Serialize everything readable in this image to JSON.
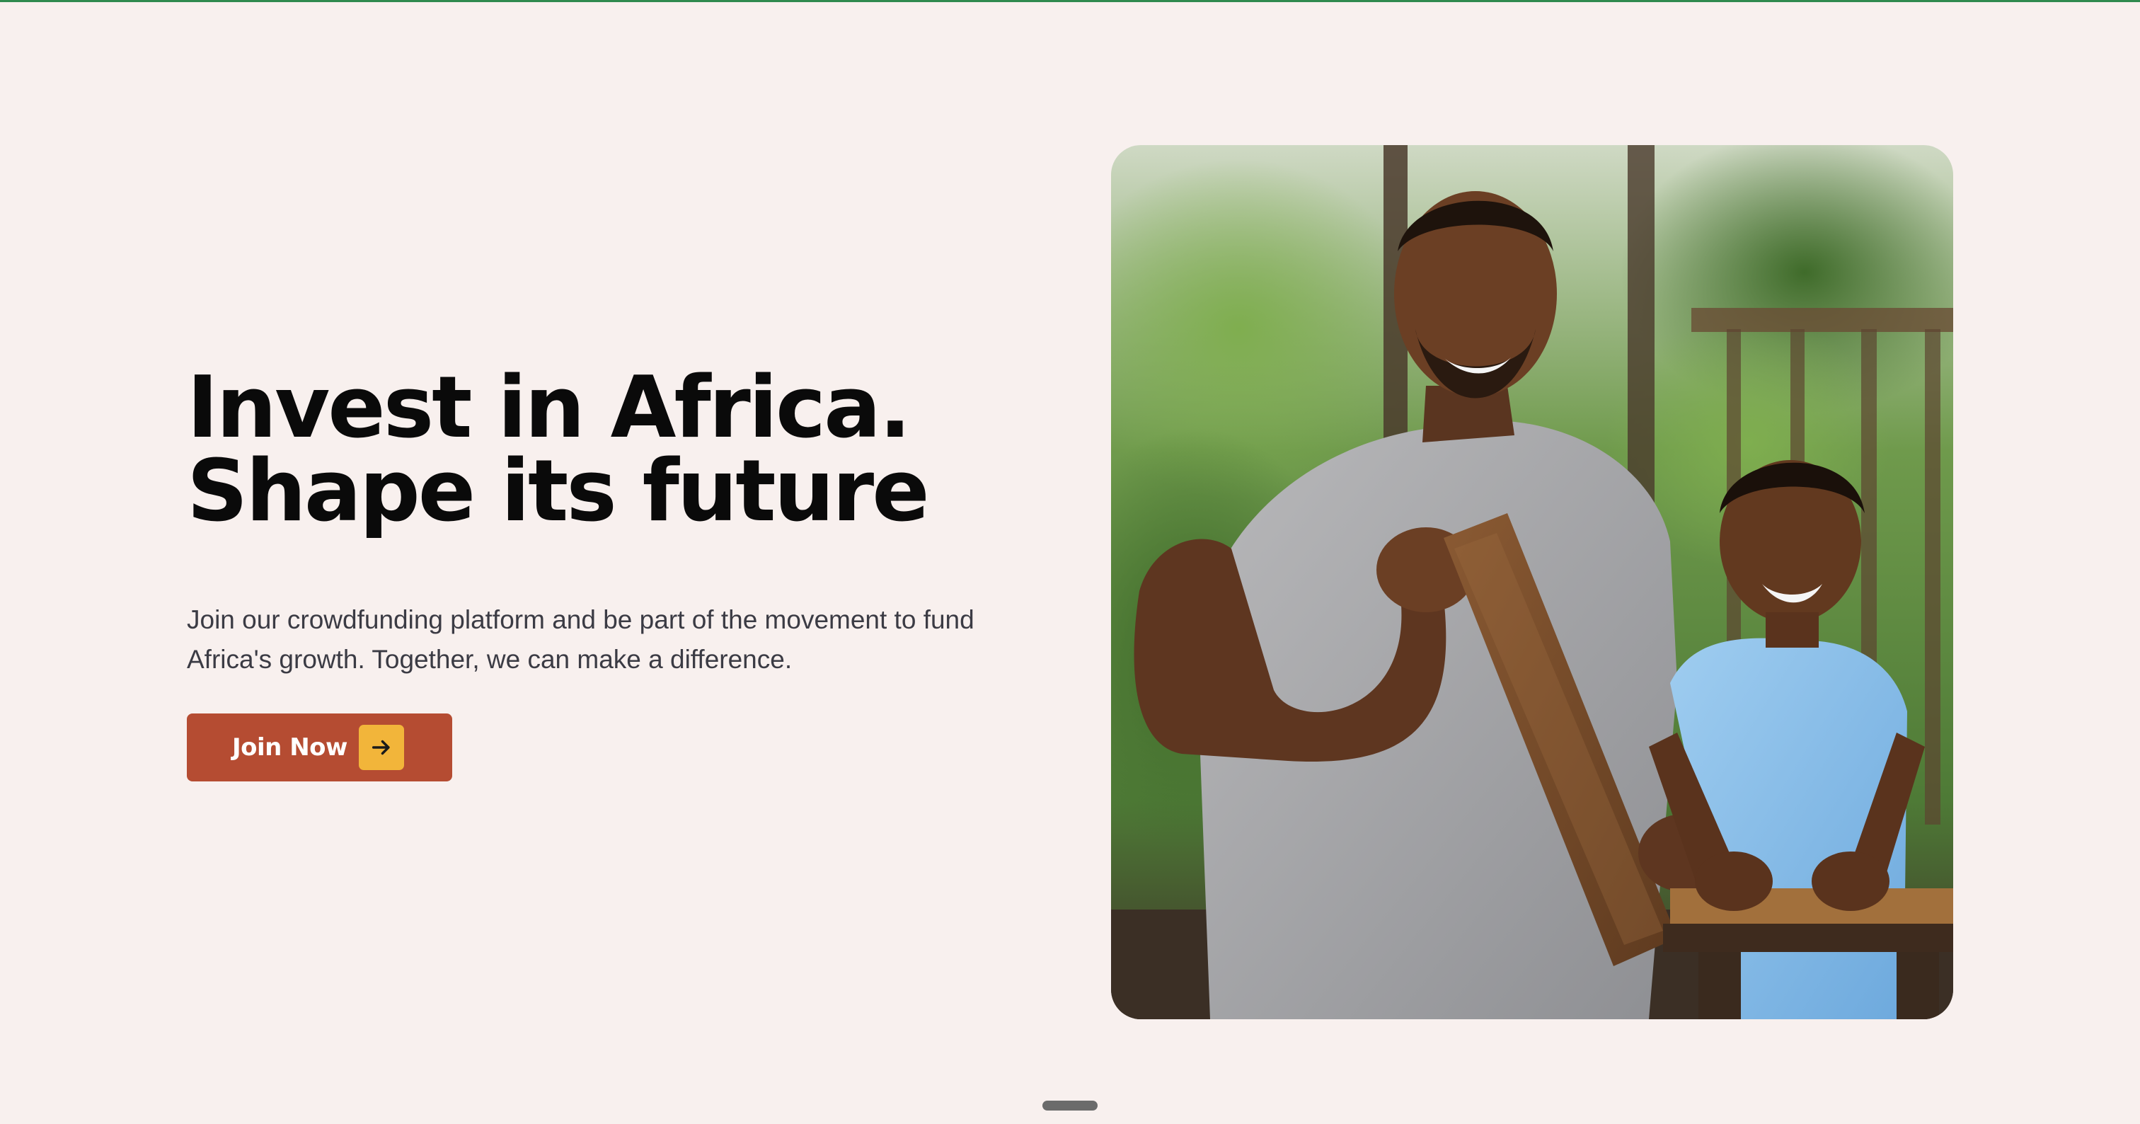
{
  "hero": {
    "headline_line1": "Invest in Africa.",
    "headline_line2": "Shape its future",
    "description": "Join our crowdfunding platform and be part of the movement to fund Africa's growth. Together, we can make a difference.",
    "cta_label": "Join Now",
    "cta_icon": "arrow-right-icon",
    "image_subject": "smiling man holding a wooden plank beside a smiling boy at a wooden workbench outdoors"
  },
  "colors": {
    "background": "#f8f0ee",
    "heading": "#0a0a0a",
    "body_text": "#3b3b44",
    "cta_background": "#b54c32",
    "cta_icon_background": "#f2b53a",
    "top_accent": "#2f8a4e"
  }
}
